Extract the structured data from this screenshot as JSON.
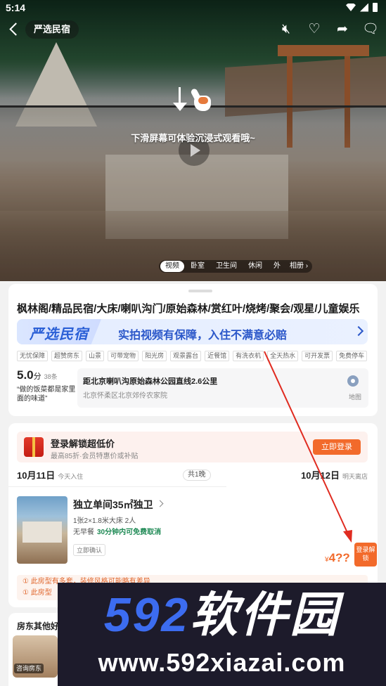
{
  "status": {
    "time": "5:14"
  },
  "header": {
    "brand": "严选民宿"
  },
  "hero": {
    "swipe_hint": "下滑屏幕可体验沉浸式观看哦~",
    "media_tabs": [
      "视频",
      "卧室",
      "卫生间",
      "休闲",
      "外"
    ],
    "album_label": "相册"
  },
  "listing": {
    "title": "枫林阁/精品民宿/大床/喇叭沟门/原始森林/赏红叶/烧烤/聚会/观星/儿童娱乐",
    "guarantee_logo": "严选民宿",
    "guarantee_text": "实拍视频有保障，入住不满意必赔",
    "tags": [
      "无忧保障",
      "超赞房东",
      "山景",
      "可带宠物",
      "阳光房",
      "观景露台",
      "近餐馆",
      "有洗衣机",
      "全天热水",
      "可开发票",
      "免费停车"
    ],
    "rating": {
      "score": "5.0",
      "unit": "分",
      "count": "38条",
      "quote": "“做的饭菜都是家里面的味道”"
    },
    "location": {
      "distance": "距北京喇叭沟原始森林公园直线2.6公里",
      "address": "北京怀柔区北京郊伶农家院",
      "map_label": "地图"
    }
  },
  "booking": {
    "login_banner": {
      "title": "登录解锁超低价",
      "subtitle": "最高85折·会员特惠价或补贴",
      "button": "立即登录"
    },
    "checkin": {
      "date": "10月11日",
      "label": "今天入住"
    },
    "nights": "共1晚",
    "checkout": {
      "date": "10月12日",
      "label": "明天离店"
    },
    "room": {
      "name": "独立单间35㎡独卫",
      "bed": "1张2×1.8米大床 2人",
      "breakfast": "无早餐",
      "cancel": "30分钟内可免费取消",
      "confirm": "立即确认",
      "price_symbol": "¥",
      "price": "4??",
      "unlock_button": "登录解锁"
    },
    "notices": [
      "① 此房型有多套，装修风格可能略有差异",
      "① 此房型"
    ]
  },
  "others": {
    "heading": "房东其他好",
    "host_chip": "咨询房东"
  },
  "watermark": {
    "brand_num": "592",
    "brand_text": "软件园",
    "url": "www.592xiazai.com"
  },
  "colors": {
    "accent": "#f26a2b",
    "guarantee_blue": "#2b57c9",
    "arrow_red": "#e02b20"
  }
}
